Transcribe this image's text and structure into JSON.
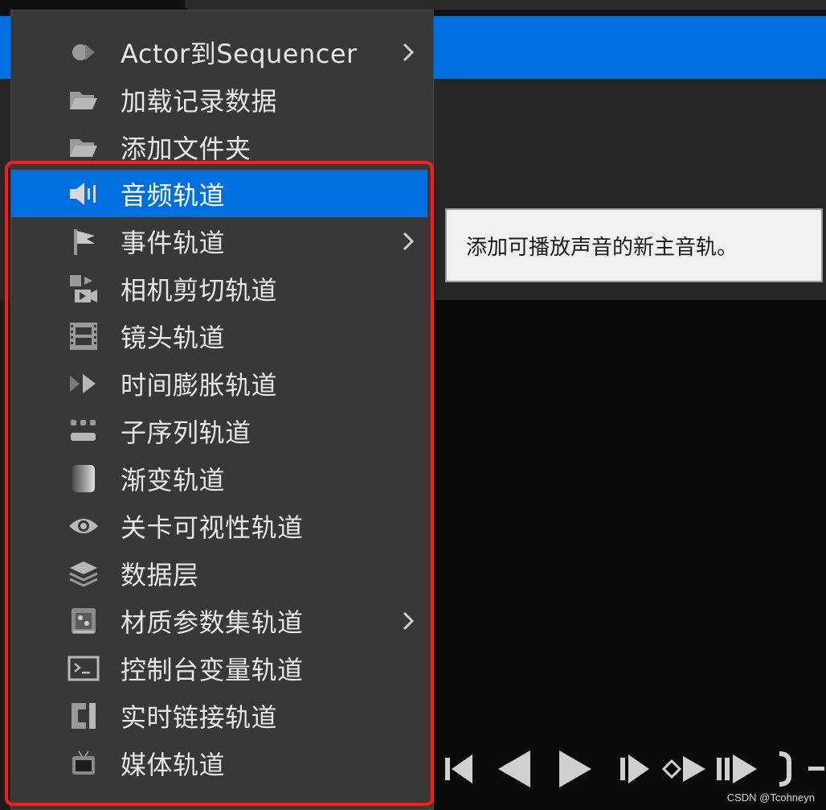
{
  "menu": {
    "items": [
      {
        "label": "Actor到Sequencer",
        "icon": "actor-diamond-icon",
        "submenu": true
      },
      {
        "label": "加载记录数据",
        "icon": "folder-open-icon",
        "submenu": false
      },
      {
        "label": "添加文件夹",
        "icon": "folder-open-icon",
        "submenu": false
      },
      {
        "label": "音频轨道",
        "icon": "speaker-icon",
        "submenu": false,
        "active": true
      },
      {
        "label": "事件轨道",
        "icon": "flag-icon",
        "submenu": true
      },
      {
        "label": "相机剪切轨道",
        "icon": "camera-cut-icon",
        "submenu": false
      },
      {
        "label": "镜头轨道",
        "icon": "film-strip-icon",
        "submenu": false
      },
      {
        "label": "时间膨胀轨道",
        "icon": "fast-forward-icon",
        "submenu": false
      },
      {
        "label": "子序列轨道",
        "icon": "subsequence-icon",
        "submenu": false
      },
      {
        "label": "渐变轨道",
        "icon": "gradient-fade-icon",
        "submenu": false
      },
      {
        "label": "关卡可视性轨道",
        "icon": "eye-icon",
        "submenu": false
      },
      {
        "label": "数据层",
        "icon": "layers-icon",
        "submenu": false
      },
      {
        "label": "材质参数集轨道",
        "icon": "material-params-icon",
        "submenu": true
      },
      {
        "label": "控制台变量轨道",
        "icon": "console-icon",
        "submenu": false
      },
      {
        "label": "实时链接轨道",
        "icon": "live-link-icon",
        "submenu": false
      },
      {
        "label": "媒体轨道",
        "icon": "tv-icon",
        "submenu": false
      }
    ]
  },
  "tooltip": {
    "text": "添加可播放声音的新主音轨。"
  },
  "transport": {
    "buttons": [
      "jump-to-start-icon",
      "step-back-icon",
      "play-icon",
      "step-forward-icon",
      "next-key-icon",
      "jump-to-end-icon",
      "loop-icon"
    ]
  },
  "watermark": {
    "text": "CSDN @Tcohneyn"
  },
  "colors": {
    "accent": "#0070e0",
    "highlight_border": "#ff1b1b",
    "menu_bg": "#383838"
  }
}
